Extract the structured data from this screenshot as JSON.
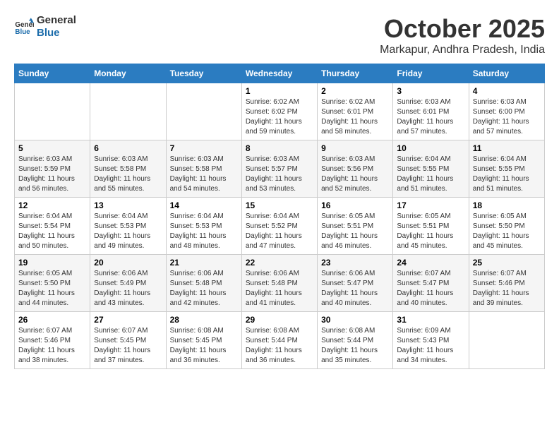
{
  "header": {
    "logo_general": "General",
    "logo_blue": "Blue",
    "month": "October 2025",
    "location": "Markapur, Andhra Pradesh, India"
  },
  "days_of_week": [
    "Sunday",
    "Monday",
    "Tuesday",
    "Wednesday",
    "Thursday",
    "Friday",
    "Saturday"
  ],
  "weeks": [
    [
      {
        "day": "",
        "info": ""
      },
      {
        "day": "",
        "info": ""
      },
      {
        "day": "",
        "info": ""
      },
      {
        "day": "1",
        "info": "Sunrise: 6:02 AM\nSunset: 6:02 PM\nDaylight: 11 hours and 59 minutes."
      },
      {
        "day": "2",
        "info": "Sunrise: 6:02 AM\nSunset: 6:01 PM\nDaylight: 11 hours and 58 minutes."
      },
      {
        "day": "3",
        "info": "Sunrise: 6:03 AM\nSunset: 6:01 PM\nDaylight: 11 hours and 57 minutes."
      },
      {
        "day": "4",
        "info": "Sunrise: 6:03 AM\nSunset: 6:00 PM\nDaylight: 11 hours and 57 minutes."
      }
    ],
    [
      {
        "day": "5",
        "info": "Sunrise: 6:03 AM\nSunset: 5:59 PM\nDaylight: 11 hours and 56 minutes."
      },
      {
        "day": "6",
        "info": "Sunrise: 6:03 AM\nSunset: 5:58 PM\nDaylight: 11 hours and 55 minutes."
      },
      {
        "day": "7",
        "info": "Sunrise: 6:03 AM\nSunset: 5:58 PM\nDaylight: 11 hours and 54 minutes."
      },
      {
        "day": "8",
        "info": "Sunrise: 6:03 AM\nSunset: 5:57 PM\nDaylight: 11 hours and 53 minutes."
      },
      {
        "day": "9",
        "info": "Sunrise: 6:03 AM\nSunset: 5:56 PM\nDaylight: 11 hours and 52 minutes."
      },
      {
        "day": "10",
        "info": "Sunrise: 6:04 AM\nSunset: 5:55 PM\nDaylight: 11 hours and 51 minutes."
      },
      {
        "day": "11",
        "info": "Sunrise: 6:04 AM\nSunset: 5:55 PM\nDaylight: 11 hours and 51 minutes."
      }
    ],
    [
      {
        "day": "12",
        "info": "Sunrise: 6:04 AM\nSunset: 5:54 PM\nDaylight: 11 hours and 50 minutes."
      },
      {
        "day": "13",
        "info": "Sunrise: 6:04 AM\nSunset: 5:53 PM\nDaylight: 11 hours and 49 minutes."
      },
      {
        "day": "14",
        "info": "Sunrise: 6:04 AM\nSunset: 5:53 PM\nDaylight: 11 hours and 48 minutes."
      },
      {
        "day": "15",
        "info": "Sunrise: 6:04 AM\nSunset: 5:52 PM\nDaylight: 11 hours and 47 minutes."
      },
      {
        "day": "16",
        "info": "Sunrise: 6:05 AM\nSunset: 5:51 PM\nDaylight: 11 hours and 46 minutes."
      },
      {
        "day": "17",
        "info": "Sunrise: 6:05 AM\nSunset: 5:51 PM\nDaylight: 11 hours and 45 minutes."
      },
      {
        "day": "18",
        "info": "Sunrise: 6:05 AM\nSunset: 5:50 PM\nDaylight: 11 hours and 45 minutes."
      }
    ],
    [
      {
        "day": "19",
        "info": "Sunrise: 6:05 AM\nSunset: 5:50 PM\nDaylight: 11 hours and 44 minutes."
      },
      {
        "day": "20",
        "info": "Sunrise: 6:06 AM\nSunset: 5:49 PM\nDaylight: 11 hours and 43 minutes."
      },
      {
        "day": "21",
        "info": "Sunrise: 6:06 AM\nSunset: 5:48 PM\nDaylight: 11 hours and 42 minutes."
      },
      {
        "day": "22",
        "info": "Sunrise: 6:06 AM\nSunset: 5:48 PM\nDaylight: 11 hours and 41 minutes."
      },
      {
        "day": "23",
        "info": "Sunrise: 6:06 AM\nSunset: 5:47 PM\nDaylight: 11 hours and 40 minutes."
      },
      {
        "day": "24",
        "info": "Sunrise: 6:07 AM\nSunset: 5:47 PM\nDaylight: 11 hours and 40 minutes."
      },
      {
        "day": "25",
        "info": "Sunrise: 6:07 AM\nSunset: 5:46 PM\nDaylight: 11 hours and 39 minutes."
      }
    ],
    [
      {
        "day": "26",
        "info": "Sunrise: 6:07 AM\nSunset: 5:46 PM\nDaylight: 11 hours and 38 minutes."
      },
      {
        "day": "27",
        "info": "Sunrise: 6:07 AM\nSunset: 5:45 PM\nDaylight: 11 hours and 37 minutes."
      },
      {
        "day": "28",
        "info": "Sunrise: 6:08 AM\nSunset: 5:45 PM\nDaylight: 11 hours and 36 minutes."
      },
      {
        "day": "29",
        "info": "Sunrise: 6:08 AM\nSunset: 5:44 PM\nDaylight: 11 hours and 36 minutes."
      },
      {
        "day": "30",
        "info": "Sunrise: 6:08 AM\nSunset: 5:44 PM\nDaylight: 11 hours and 35 minutes."
      },
      {
        "day": "31",
        "info": "Sunrise: 6:09 AM\nSunset: 5:43 PM\nDaylight: 11 hours and 34 minutes."
      },
      {
        "day": "",
        "info": ""
      }
    ]
  ]
}
